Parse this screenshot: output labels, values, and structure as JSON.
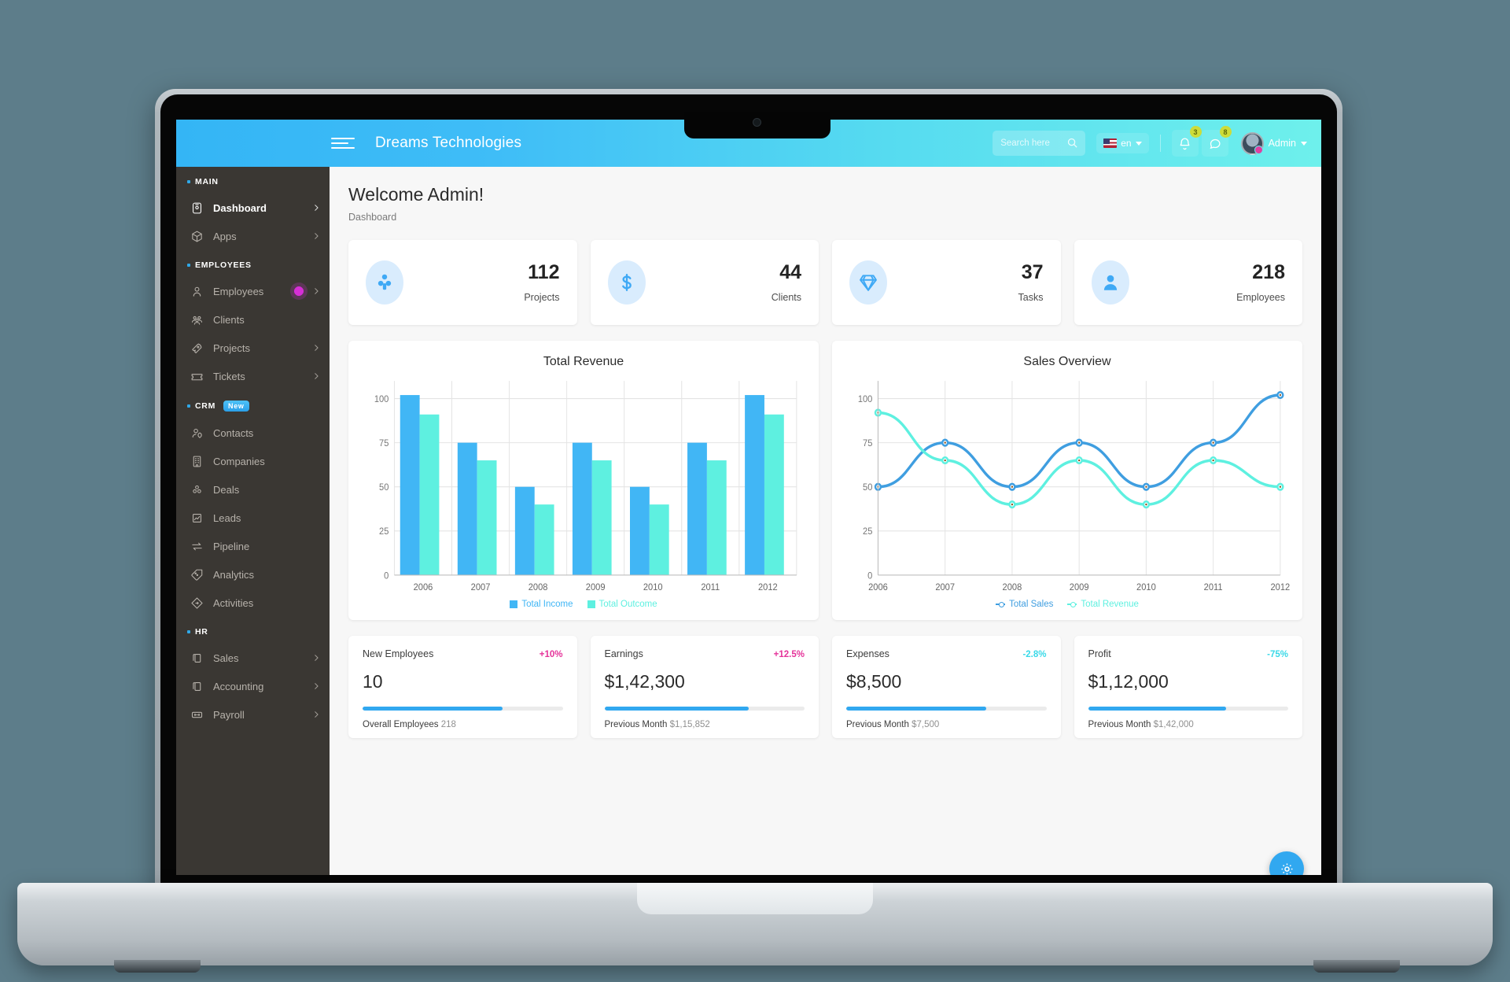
{
  "navbar": {
    "brand": "Dreams Technologies",
    "menu_icon": "hamburger-icon",
    "search_placeholder": "Search here",
    "language": "en",
    "notification_badge": "3",
    "message_badge": "8",
    "user_name": "Admin"
  },
  "sidebar": {
    "sections": [
      {
        "title": "MAIN",
        "badge": null,
        "items": [
          {
            "label": "Dashboard",
            "icon": "dashboard-icon",
            "active": true,
            "chevron": true,
            "pulse": false
          },
          {
            "label": "Apps",
            "icon": "apps-cube-icon",
            "active": false,
            "chevron": true,
            "pulse": false
          }
        ]
      },
      {
        "title": "EMPLOYEES",
        "badge": null,
        "items": [
          {
            "label": "Employees",
            "icon": "user-icon",
            "active": false,
            "chevron": true,
            "pulse": true
          },
          {
            "label": "Clients",
            "icon": "clients-group-icon",
            "active": false,
            "chevron": false,
            "pulse": false
          },
          {
            "label": "Projects",
            "icon": "rocket-icon",
            "active": false,
            "chevron": true,
            "pulse": false
          },
          {
            "label": "Tickets",
            "icon": "ticket-icon",
            "active": false,
            "chevron": true,
            "pulse": false
          }
        ]
      },
      {
        "title": "CRM",
        "badge": "New",
        "items": [
          {
            "label": "Contacts",
            "icon": "contacts-icon",
            "active": false,
            "chevron": false,
            "pulse": false
          },
          {
            "label": "Companies",
            "icon": "building-icon",
            "active": false,
            "chevron": false,
            "pulse": false
          },
          {
            "label": "Deals",
            "icon": "deals-icon",
            "active": false,
            "chevron": false,
            "pulse": false
          },
          {
            "label": "Leads",
            "icon": "leads-chart-icon",
            "active": false,
            "chevron": false,
            "pulse": false
          },
          {
            "label": "Pipeline",
            "icon": "pipeline-arrows-icon",
            "active": false,
            "chevron": false,
            "pulse": false
          },
          {
            "label": "Analytics",
            "icon": "analytics-tag-icon",
            "active": false,
            "chevron": false,
            "pulse": false
          },
          {
            "label": "Activities",
            "icon": "activities-diamond-icon",
            "active": false,
            "chevron": false,
            "pulse": false
          }
        ]
      },
      {
        "title": "HR",
        "badge": null,
        "items": [
          {
            "label": "Sales",
            "icon": "copy-icon",
            "active": false,
            "chevron": true,
            "pulse": false
          },
          {
            "label": "Accounting",
            "icon": "copy-icon",
            "active": false,
            "chevron": true,
            "pulse": false
          },
          {
            "label": "Payroll",
            "icon": "payroll-icon",
            "active": false,
            "chevron": true,
            "pulse": false
          }
        ]
      }
    ]
  },
  "page": {
    "title": "Welcome Admin!",
    "breadcrumb": "Dashboard"
  },
  "stats": [
    {
      "value": "112",
      "label": "Projects",
      "icon": "projects-icon"
    },
    {
      "value": "44",
      "label": "Clients",
      "icon": "dollar-icon"
    },
    {
      "value": "37",
      "label": "Tasks",
      "icon": "diamond-icon"
    },
    {
      "value": "218",
      "label": "Employees",
      "icon": "person-icon"
    }
  ],
  "chart_data": [
    {
      "type": "bar",
      "title": "Total Revenue",
      "categories": [
        "2006",
        "2007",
        "2008",
        "2009",
        "2010",
        "2011",
        "2012"
      ],
      "series": [
        {
          "name": "Total Income",
          "color": "#41b6f5",
          "values": [
            102,
            75,
            50,
            75,
            50,
            75,
            102
          ]
        },
        {
          "name": "Total Outcome",
          "color": "#5ef0e0",
          "values": [
            91,
            65,
            40,
            65,
            40,
            65,
            91
          ]
        }
      ],
      "xlabel": "",
      "ylabel": "",
      "ylim": [
        0,
        110
      ],
      "yticks": [
        0,
        25,
        50,
        75,
        100
      ],
      "grid": true,
      "legend_position": "bottom"
    },
    {
      "type": "line",
      "title": "Sales Overview",
      "categories": [
        "2006",
        "2007",
        "2008",
        "2009",
        "2010",
        "2011",
        "2012"
      ],
      "series": [
        {
          "name": "Total Sales",
          "color": "#3f9ee0",
          "values": [
            50,
            75,
            50,
            75,
            50,
            75,
            102
          ]
        },
        {
          "name": "Total Revenue",
          "color": "#5ef0e0",
          "values": [
            92,
            65,
            40,
            65,
            40,
            65,
            50
          ]
        }
      ],
      "xlabel": "",
      "ylabel": "",
      "ylim": [
        0,
        110
      ],
      "yticks": [
        0,
        25,
        50,
        75,
        100
      ],
      "grid": true,
      "legend_position": "bottom"
    }
  ],
  "metrics": [
    {
      "label": "New Employees",
      "delta": "+10%",
      "delta_color": "#e5339a",
      "value": "10",
      "progress": 70,
      "sub_label": "Overall Employees",
      "sub_value": "218"
    },
    {
      "label": "Earnings",
      "delta": "+12.5%",
      "delta_color": "#e5339a",
      "value": "$1,42,300",
      "progress": 72,
      "sub_label": "Previous Month",
      "sub_value": "$1,15,852"
    },
    {
      "label": "Expenses",
      "delta": "-2.8%",
      "delta_color": "#3ad9e8",
      "value": "$8,500",
      "progress": 70,
      "sub_label": "Previous Month",
      "sub_value": "$7,500"
    },
    {
      "label": "Profit",
      "delta": "-75%",
      "delta_color": "#3ad9e8",
      "value": "$1,12,000",
      "progress": 69,
      "sub_label": "Previous Month",
      "sub_value": "$1,42,000"
    }
  ],
  "fab": {
    "icon": "gear-icon",
    "color": "#31a8f0"
  }
}
